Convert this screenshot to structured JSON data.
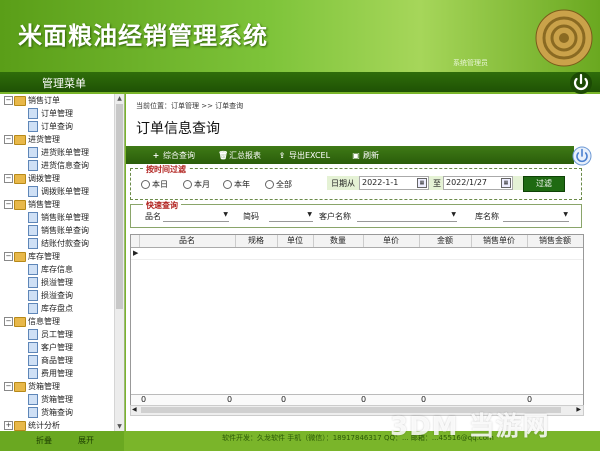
{
  "header": {
    "title": "米面粮油经销管理系统",
    "user": "系统管理员"
  },
  "menubar": {
    "title": "管理菜单"
  },
  "sidebar": {
    "groups": [
      {
        "label": "销售订单",
        "items": [
          "订单管理",
          "订单查询"
        ]
      },
      {
        "label": "进货管理",
        "items": [
          "进货账单管理",
          "进货信息查询"
        ]
      },
      {
        "label": "调拨管理",
        "items": [
          "调拨账单管理"
        ]
      },
      {
        "label": "销售管理",
        "items": [
          "销售账单管理",
          "销售账单查询",
          "结账付款查询"
        ]
      },
      {
        "label": "库存管理",
        "items": [
          "库存信息",
          "损溢管理",
          "损溢查询",
          "库存盘点"
        ]
      },
      {
        "label": "信息管理",
        "items": [
          "员工管理",
          "客户管理",
          "商品管理",
          "费用管理"
        ]
      },
      {
        "label": "货箱管理",
        "items": [
          "货箱管理",
          "货箱查询"
        ]
      },
      {
        "label": "统计分析",
        "items": []
      }
    ],
    "footer": {
      "collapse": "折叠",
      "expand": "展开"
    }
  },
  "main": {
    "breadcrumb": "当前位置：订单管理 >> 订单查询",
    "title": "订单信息查询",
    "toolbar": [
      {
        "icon": "plus-icon",
        "glyph": "+",
        "label": "综合查询"
      },
      {
        "icon": "trash-icon",
        "glyph": "🗑",
        "label": "汇总报表"
      },
      {
        "icon": "export-icon",
        "glyph": "⇪",
        "label": "导出EXCEL"
      },
      {
        "icon": "refresh-icon",
        "glyph": "▣",
        "label": "刷新"
      }
    ],
    "time_filter": {
      "legend": "按时间过滤",
      "options": [
        "本日",
        "本月",
        "本年",
        "全部"
      ],
      "date_from_label": "日期从",
      "date_from": "2022-1-1",
      "date_to_label": "至",
      "date_to": "2022/1/27",
      "button": "过滤"
    },
    "quick": {
      "legend": "快速查询",
      "fields": [
        "品名",
        "简码",
        "客户名称",
        "库名称"
      ]
    },
    "grid": {
      "columns": [
        "品名",
        "规格",
        "单位",
        "数量",
        "单价",
        "金额",
        "销售单价",
        "销售金额"
      ],
      "row_marker": "▶",
      "footer": [
        "0",
        "0",
        "0",
        "0",
        "0",
        "0"
      ]
    }
  },
  "footer": {
    "text": "软件开发：久龙软件  手机（微信）：18917846317  QQ：...  邮箱：...45516@qq.com",
    "watermark": "3DM 当游网"
  }
}
